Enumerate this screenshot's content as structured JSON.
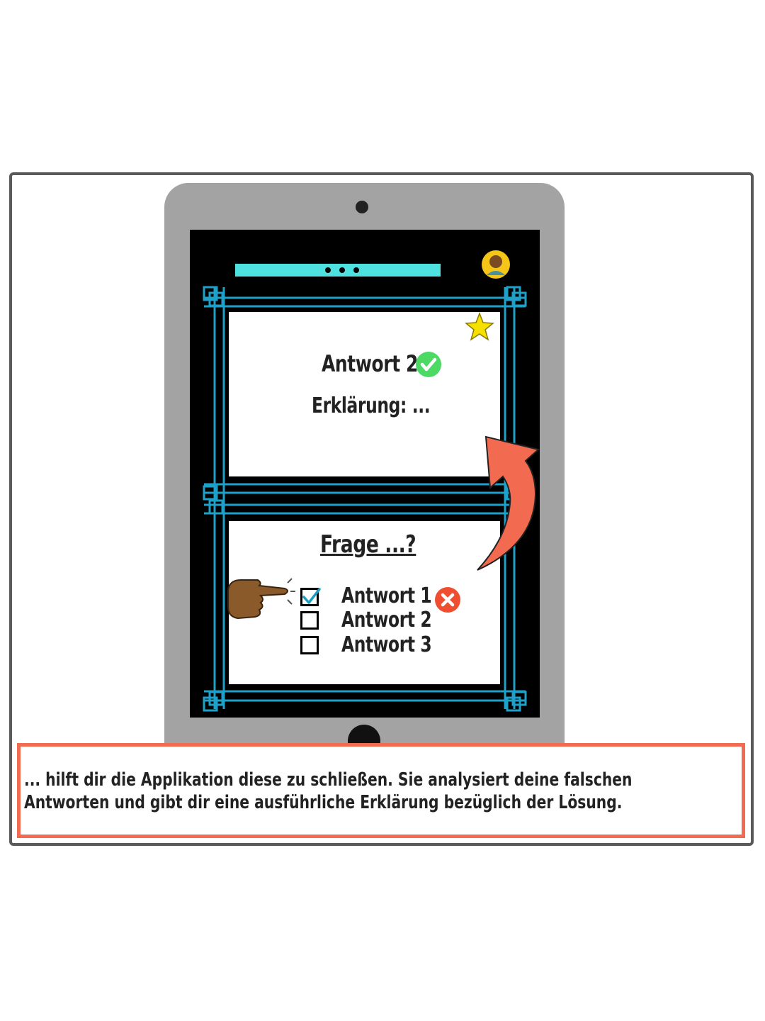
{
  "quiz": {
    "answer_card": {
      "answer": "Antwort 2",
      "explanation": "Erklärung: ..."
    },
    "question_card": {
      "question": "Frage ...?",
      "options": [
        {
          "label": "Antwort 1",
          "checked": true,
          "status": "wrong"
        },
        {
          "label": "Antwort 2",
          "checked": false
        },
        {
          "label": "Antwort 3",
          "checked": false
        }
      ]
    }
  },
  "caption": {
    "line1": "... hilft dir die Applikation diese zu schließen. Sie analysiert deine falschen",
    "line2": "Antworten und gibt dir eine ausführliche Erklärung bezüglich der Lösung."
  },
  "colors": {
    "progress": "#4fe0e0",
    "frame": "#1ea0c8",
    "correct": "#4cd964",
    "wrong": "#f04e30",
    "arrow": "#f26b51",
    "star": "#f5e000"
  }
}
